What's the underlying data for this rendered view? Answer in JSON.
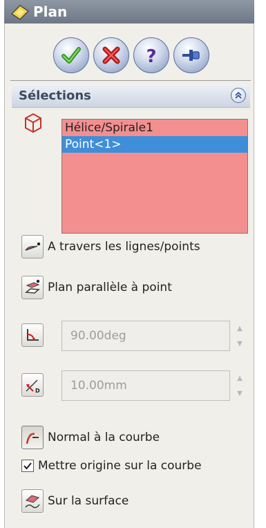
{
  "window": {
    "title": "Plan"
  },
  "actions": [
    {
      "name": "ok-button",
      "icon": "check-icon"
    },
    {
      "name": "cancel-button",
      "icon": "close-icon"
    },
    {
      "name": "help-button",
      "icon": "help-icon"
    },
    {
      "name": "pin-button",
      "icon": "pin-icon"
    }
  ],
  "selections": {
    "title": "Sélections",
    "items": [
      "Hélice/Spirale1",
      "Point<1>"
    ],
    "selected_index": 1,
    "list_color": "#f48f8f",
    "highlight_color": "#3f8ed9"
  },
  "options": {
    "through_lines": "A travers les lignes/points",
    "parallel_plane": "Plan parallèle à point",
    "angle_value": "90.00deg",
    "offset_value": "10.00mm",
    "normal_curve": "Normal à la courbe",
    "origin_checkbox": "Mettre origine sur la courbe",
    "origin_checked": true,
    "on_surface": "Sur la surface"
  },
  "colors": {
    "titlebar": "#7e8794",
    "panel": "#f0efea",
    "accent": "#3f8ed9"
  }
}
